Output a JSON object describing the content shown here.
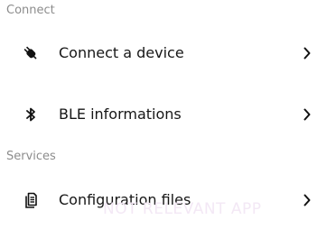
{
  "sections": [
    {
      "header": "Connect",
      "items": [
        {
          "label": "Connect a device",
          "icon": "plug-icon"
        },
        {
          "label": "BLE informations",
          "icon": "bluetooth-icon"
        }
      ]
    },
    {
      "header": "Services",
      "items": [
        {
          "label": "Configuration files",
          "icon": "document-icon"
        }
      ]
    }
  ],
  "watermark": "NOT RELEVANT APP"
}
